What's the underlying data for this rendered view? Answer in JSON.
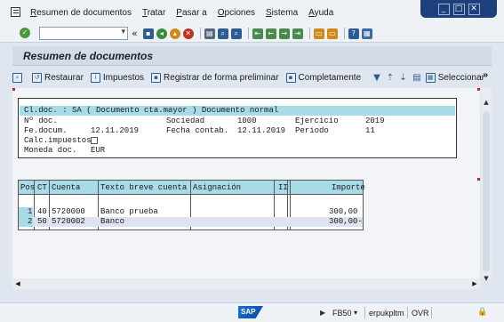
{
  "menu": [
    "Resumen de documentos",
    "Tratar",
    "Pasar a",
    "Opciones",
    "Sistema",
    "Ayuda"
  ],
  "window_controls": {
    "minimize": "_",
    "maximize": "□",
    "close": "✕"
  },
  "toolbar": {
    "command_value": "",
    "collapse_label": "«"
  },
  "title": "Resumen de documentos",
  "app_toolbar": {
    "restore": "Restaurar",
    "taxes": "Impuestos",
    "park": "Registrar de forma preliminar",
    "complete": "Completamente",
    "select": "Seleccionar",
    "more": "»"
  },
  "doc_header": {
    "title_line": "Cl.doc. : SA ( Documento cta.mayor ) Documento normal",
    "doc_no_label": "Nº doc.",
    "company_label": "Sociedad",
    "company_value": "1000",
    "fiscal_year_label": "Ejercicio",
    "fiscal_year_value": "2019",
    "doc_date_label": "Fe.docum.",
    "doc_date_value": "12.11.2019",
    "posting_date_label": "Fecha contab.",
    "posting_date_value": "12.11.2019",
    "period_label": "Periodo",
    "period_value": "11",
    "calc_tax_label": "Calc.impuestos",
    "currency_label": "Moneda doc.",
    "currency_value": "EUR"
  },
  "items": {
    "headers": [
      "Pos",
      "CT",
      "Cuenta",
      "Texto breve cuenta",
      "Asignación",
      "II",
      "Importe"
    ],
    "rows": [
      {
        "pos": "1",
        "ct": "40",
        "account": "5720000",
        "text": "Banco prueba",
        "assignment": "",
        "ii": "",
        "amount": "300,00"
      },
      {
        "pos": "2",
        "ct": "50",
        "account": "5720002",
        "text": "Banco",
        "assignment": "",
        "ii": "",
        "amount": "300,00-"
      }
    ]
  },
  "status_bar": {
    "logo": "SAP",
    "transaction": "FB50",
    "server": "erpukpltm",
    "mode": "OVR"
  },
  "colors": {
    "accent_blue": "#1d3f7a",
    "highlight_cyan": "#a8dbe8",
    "background": "#dfe6ef"
  }
}
